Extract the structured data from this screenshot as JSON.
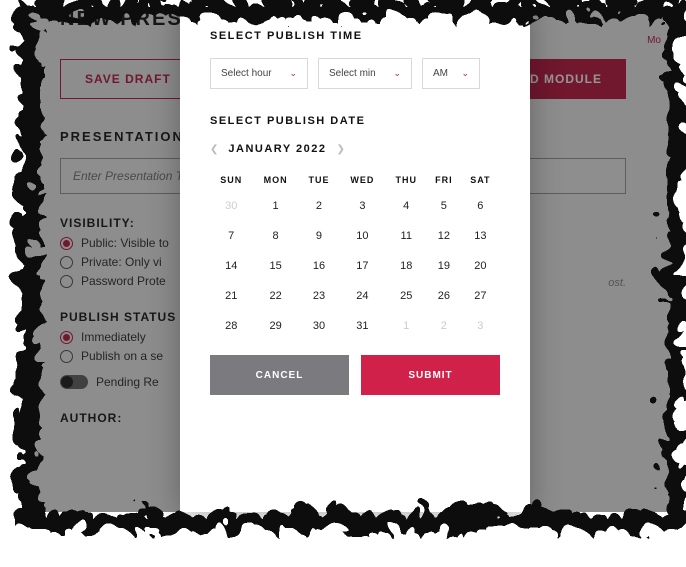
{
  "bg": {
    "title": "NEW PRESENTATION",
    "save_draft": "SAVE DRAFT",
    "add_module": "ADD MODULE",
    "section_title": "PRESENTATION TITLE",
    "title_placeholder": "Enter Presentation Title",
    "visibility_label": "VISIBILITY:",
    "visibility": {
      "public": "Public: Visible to",
      "private": "Private: Only vi",
      "password": "Password Prote"
    },
    "status_label": "PUBLISH STATUS",
    "status": {
      "immediately": "Immediately",
      "schedule": "Publish on a se"
    },
    "pending": "Pending Re",
    "author_label": "AUTHOR:",
    "trail": "ost.",
    "morelink": "Mo"
  },
  "modal": {
    "time_heading": "SELECT PUBLISH TIME",
    "select_hour": "Select hour",
    "select_min": "Select min",
    "ampm": "AM",
    "date_heading": "SELECT PUBLISH DATE",
    "month_label": "JANUARY 2022",
    "dow": [
      "SUN",
      "MON",
      "TUE",
      "WED",
      "THU",
      "FRI",
      "SAT"
    ],
    "weeks": [
      [
        {
          "d": "30",
          "m": true
        },
        {
          "d": "1"
        },
        {
          "d": "2"
        },
        {
          "d": "3"
        },
        {
          "d": "4"
        },
        {
          "d": "5"
        },
        {
          "d": "6"
        }
      ],
      [
        {
          "d": "7"
        },
        {
          "d": "8"
        },
        {
          "d": "9"
        },
        {
          "d": "10"
        },
        {
          "d": "11"
        },
        {
          "d": "12"
        },
        {
          "d": "13"
        }
      ],
      [
        {
          "d": "14"
        },
        {
          "d": "15"
        },
        {
          "d": "16"
        },
        {
          "d": "17"
        },
        {
          "d": "18"
        },
        {
          "d": "19"
        },
        {
          "d": "20"
        }
      ],
      [
        {
          "d": "21"
        },
        {
          "d": "22"
        },
        {
          "d": "23"
        },
        {
          "d": "24"
        },
        {
          "d": "25"
        },
        {
          "d": "26"
        },
        {
          "d": "27"
        }
      ],
      [
        {
          "d": "28"
        },
        {
          "d": "29"
        },
        {
          "d": "30"
        },
        {
          "d": "31"
        },
        {
          "d": "1",
          "m": true
        },
        {
          "d": "2",
          "m": true
        },
        {
          "d": "3",
          "m": true
        }
      ]
    ],
    "cancel": "CANCEL",
    "submit": "SUBMIT"
  }
}
